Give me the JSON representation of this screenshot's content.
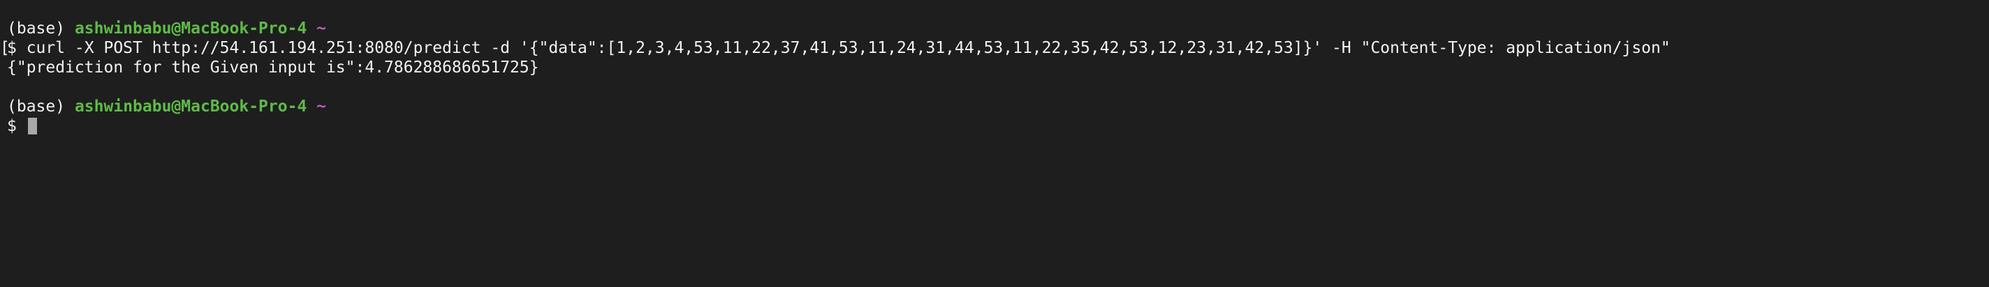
{
  "session": {
    "prompt1": {
      "env": "(base)",
      "user_host": "ashwinbabu@MacBook-Pro-4",
      "dir": "~"
    },
    "command": {
      "bracket": "[",
      "text": "$ curl -X POST http://54.161.194.251:8080/predict -d '{\"data\":[1,2,3,4,53,11,22,37,41,53,11,24,31,44,53,11,22,35,42,53,12,23,31,42,53]}' -H \"Content-Type: application/json\""
    },
    "output": "{\"prediction for the Given input is\":4.786288686651725}",
    "prompt2": {
      "env": "(base)",
      "user_host": "ashwinbabu@MacBook-Pro-4",
      "dir": "~"
    },
    "input_prompt": "$ "
  },
  "colors": {
    "background": "#1e1e1e",
    "text": "#f2f2f2",
    "user_host": "#5fbb47",
    "tilde": "#c25bc6",
    "cursor": "#a8a8a8"
  }
}
